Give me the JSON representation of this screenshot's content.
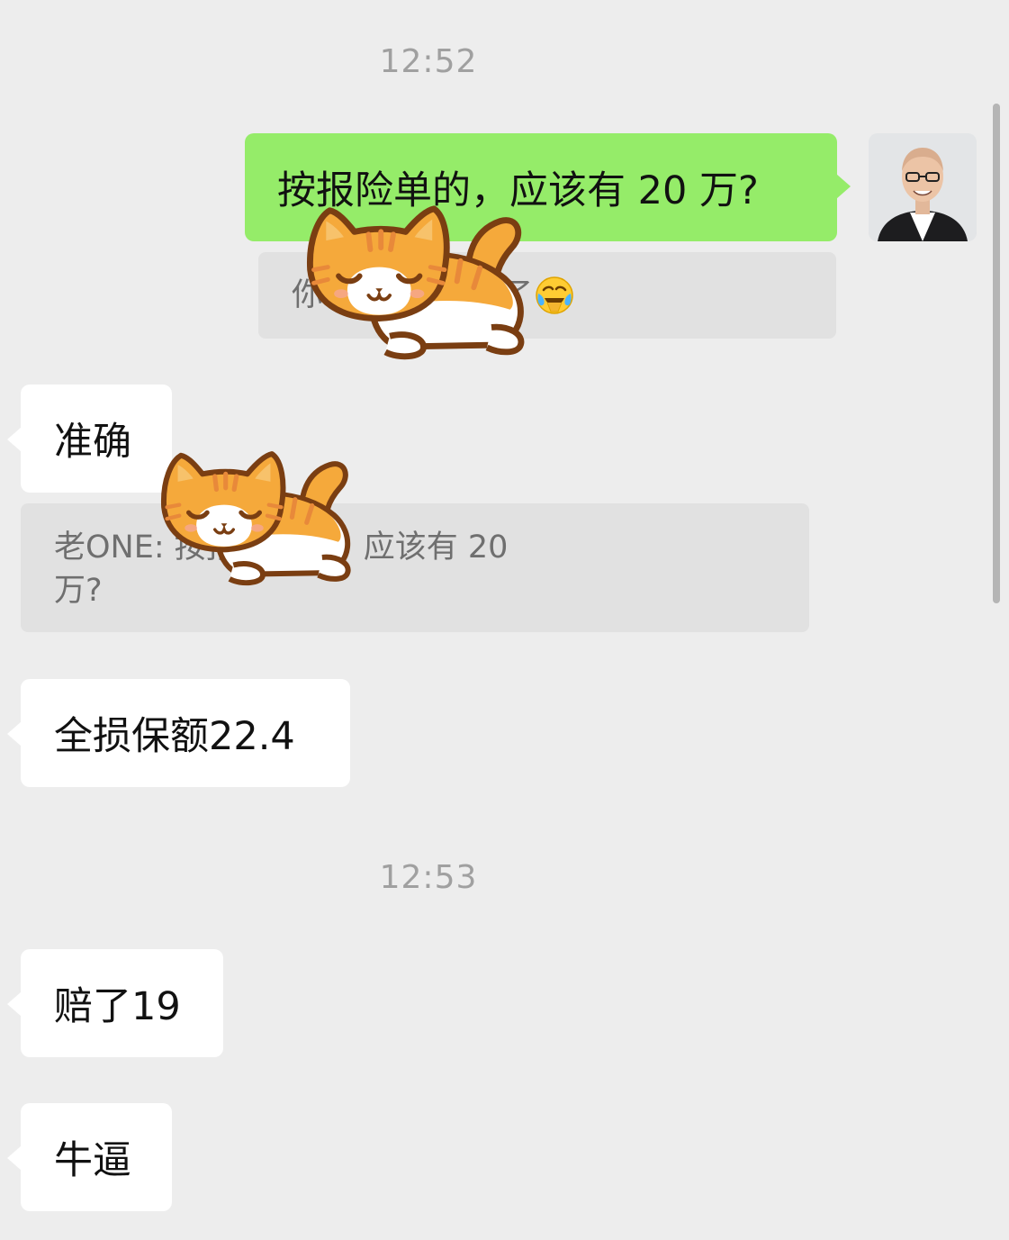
{
  "timestamps": [
    "12:52",
    "12:53"
  ],
  "messages": {
    "out_1": "按报险单的，应该有 20 万?",
    "out_1_quote": "你: 我的撞报废了",
    "in_1": "准确",
    "in_1_quote_line1": "老ONE: 按报险单的，应该有 20",
    "in_1_quote_line2": "万?",
    "in_2": "全损保额22.4",
    "in_3": "赔了19",
    "in_4": "牛逼"
  },
  "icons": {
    "avatar": "user-avatar",
    "sticker": "sleeping-cat-sticker",
    "emoji": "face-with-tears-emoji"
  },
  "colors": {
    "background": "#ededed",
    "outgoing_bubble": "#95ec69",
    "incoming_bubble": "#ffffff",
    "quote_bg": "#e1e1e1",
    "cat_orange": "#f5a93b"
  }
}
